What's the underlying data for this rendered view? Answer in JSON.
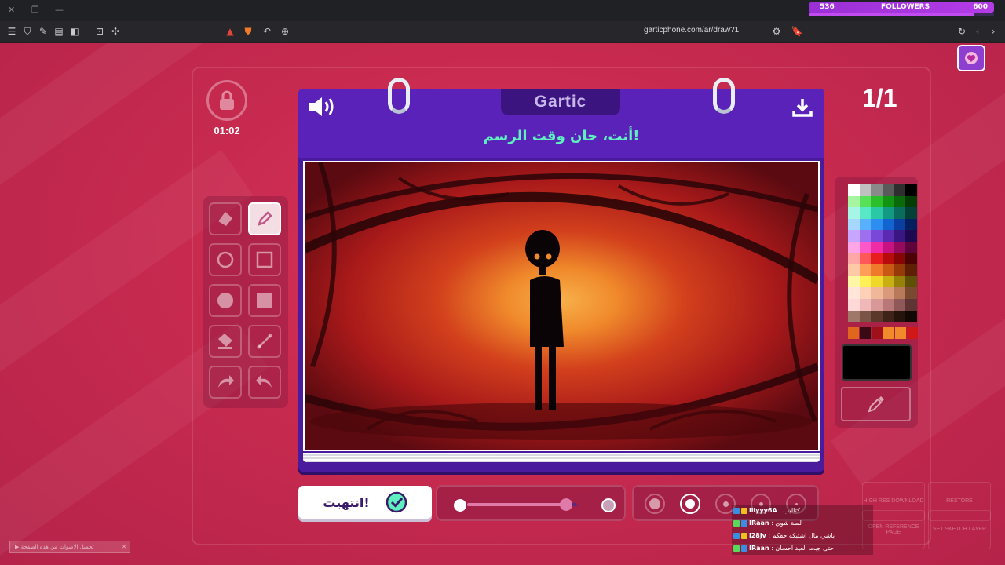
{
  "overlay": {
    "followers_current": "536",
    "followers_label": "FOLLOWERS",
    "followers_goal": "600",
    "followers_progress": 0.893
  },
  "browser": {
    "url": "garticphone.com/ar/draw?1"
  },
  "game": {
    "timer": "01:02",
    "round": "1/1",
    "logo": "Gartic",
    "prompt": "أنت، حان وقت الرسم!",
    "done_label": "انتهيت!",
    "opacity_progress": 0.9,
    "selected_tool": "pencil",
    "selected_size_index": 1,
    "current_color": "#000000"
  },
  "palette": {
    "colors": [
      "#ffffff",
      "#c0c0c0",
      "#8a8a8a",
      "#5a5a5a",
      "#2e2e2e",
      "#000000",
      "#a6f5a0",
      "#58e058",
      "#2bc02b",
      "#129412",
      "#0a6a0a",
      "#043d04",
      "#a6f5e6",
      "#58e8c8",
      "#2bc8a6",
      "#129a82",
      "#0a6c5c",
      "#044038",
      "#a6d8ff",
      "#58b0ff",
      "#2b8ef0",
      "#1264d0",
      "#0a3ea0",
      "#041e60",
      "#c8a6ff",
      "#9e70f0",
      "#7a48d8",
      "#5a2ab0",
      "#3a1682",
      "#1e0850",
      "#ffa6e6",
      "#ff58c8",
      "#f02ba6",
      "#c81282",
      "#960a5e",
      "#5e043a",
      "#ffa6a6",
      "#ff5858",
      "#e81e1e",
      "#b80c0c",
      "#860606",
      "#4a0202",
      "#ffc8a6",
      "#ff9e58",
      "#f07a2b",
      "#c85812",
      "#963a0a",
      "#5e2004",
      "#fff6a6",
      "#fff058",
      "#f0d82b",
      "#c8b012",
      "#968208",
      "#5e5004",
      "#ffe6d8",
      "#ffd0b8",
      "#f0b898",
      "#d89a7a",
      "#b87a5a",
      "#7a4a30",
      "#ffd8d8",
      "#f0b8b8",
      "#d89898",
      "#b87878",
      "#905858",
      "#5e3434",
      "#a0786a",
      "#7a5446",
      "#5a382a",
      "#3e2418",
      "#26140c",
      "#120804"
    ],
    "recent": [
      "#e0661e",
      "#3a0a14",
      "#a01018",
      "#f08a2b",
      "#f08a2b",
      "#d01818"
    ]
  },
  "buttons": {
    "high_res": "HIGH RES DOWNLOAD",
    "restore": "RESTORE",
    "open_reference": "OPEN REFERENCE PAGE",
    "set_sketch": "SET SKETCH LAYER"
  },
  "chat": [
    {
      "user": "lilyyy6A",
      "message": "كتاليب"
    },
    {
      "user": "IRaan",
      "message": "لسة شوي"
    },
    {
      "user": "i28jv",
      "message": "ياشي مال اشتيكه حقكم"
    },
    {
      "user": "IRaan",
      "message": "حتى جبت العيد احسان"
    }
  ],
  "banner": {
    "text": "تحميل الاصوات من هذه الصفحة"
  }
}
